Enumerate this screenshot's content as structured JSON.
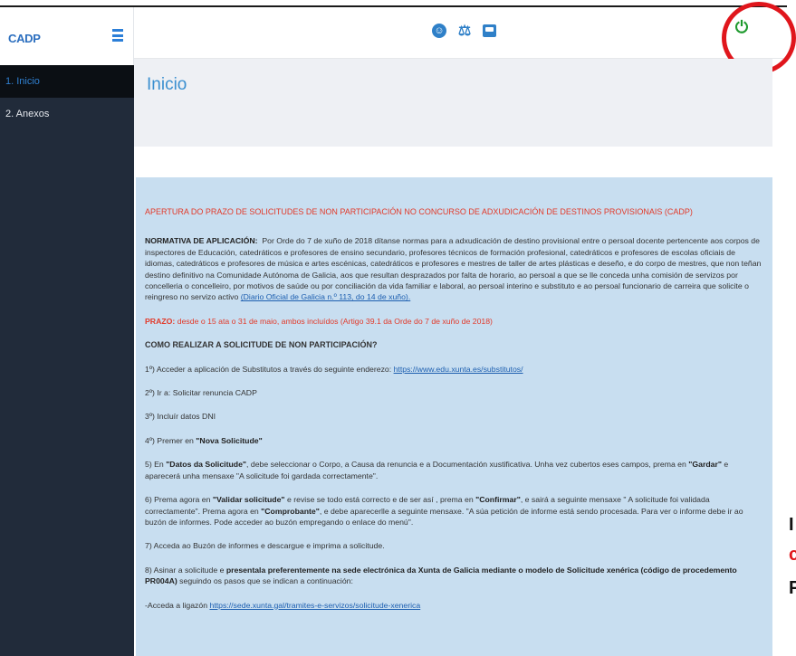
{
  "app": {
    "brand": "CADP"
  },
  "sidebar": {
    "items": [
      {
        "label": "1. Inicio"
      },
      {
        "label": "2. Anexos"
      }
    ]
  },
  "page": {
    "title": "Inicio"
  },
  "content": {
    "announcement_title": "APERTURA DO PRAZO DE SOLICITUDES DE NON PARTICIPACIÓN NO CONCURSO DE ADXUDICACIÓN DE DESTINOS PROVISIONAIS (CADP)",
    "normativa_label": "NORMATIVA DE APLICACIÓN:",
    "normativa_text": "Por Orde do 7 de xuño de 2018 dítanse normas para a adxudicación de destino provisional entre o persoal docente pertencente aos corpos de inspectores de Educación, catedráticos e profesores de ensino secundario, profesores técnicos de formación profesional, catedráticos e profesores de escolas oficiais de idiomas, catedráticos e profesores de música e artes escénicas, catedráticos e profesores e mestres de taller de artes plásticas e deseño, e do corpo de mestres, que non teñan destino definitivo na Comunidade Autónoma de Galicia, aos que resultan desprazados por falta de horario, ao persoal a que se lle conceda unha comisión de servizos por concelleria o concelleiro, por motivos de saúde ou por conciliación da vida familiar e laboral, ao persoal interino e substituto e ao persoal funcionario de carreira que solicite o reingreso no servizo activo",
    "normativa_link": "(Diario Oficial de Galicia n.º 113, do 14 de xuño).",
    "prazo_label": "PRAZO:",
    "prazo_text": "desde o 15 ata o 31 de maio, ambos incluídos (Artigo 39.1 da Orde do 7 de xuño de 2018)",
    "how_title": "COMO REALIZAR A SOLICITUDE DE NON PARTICIPACIÓN?",
    "step1_text": "1º) Acceder a aplicación de Substitutos a través do seguinte enderezo:",
    "step1_link": "https://www.edu.xunta.es/substitutos/",
    "step2": "2º) Ir a: Solicitar renuncia CADP",
    "step3": "3º) Incluír datos DNI",
    "step4_a": "4º) Premer en ",
    "step4_b": "\"Nova Solicitude\"",
    "step5_a": "5) En ",
    "step5_b": "\"Datos da Solicitude\"",
    "step5_c": ", debe seleccionar o Corpo, a Causa da renuncia e a Documentación xustificativa. Unha vez cubertos eses campos, prema en ",
    "step5_d": "\"Gardar\"",
    "step5_e": " e aparecerá unha mensaxe \"A solicitude foi gardada correctamente\".",
    "step6_a": "6) Prema agora en ",
    "step6_b": "\"Validar solicitude\"",
    "step6_c": " e revise se todo está correcto e de ser así , prema en ",
    "step6_d": "\"Confirmar\"",
    "step6_e": ", e sairá a seguinte mensaxe \" A solicitude foi validada correctamente\". Prema agora en ",
    "step6_f": "\"Comprobante\"",
    "step6_g": ", e debe aparecerlle a seguinte mensaxe. \"A súa petición de informe está sendo procesada. Para ver o informe debe ir ao buzón de informes. Pode acceder ao buzón empregando o enlace do menú\".",
    "step7": "7) Acceda ao Buzón de informes e descargue e imprima a solicitude.",
    "step8_a": "8) Asinar a solicitude e ",
    "step8_b": "presentala preferentemente na sede electrónica da Xunta de Galicia mediante o modelo de Solicitude xenérica (código de procedemento PR004A)",
    "step8_c": " seguindo os pasos que se indican a continuación:",
    "step9_text": "-Acceda a ligazón",
    "step9_link": "https://sede.xunta.gal/tramites-e-servizos/solicitude-xenerica"
  },
  "edge_glyphs": [
    "I",
    "c",
    "P"
  ],
  "colors": {
    "sidebar_bg": "#212b3a",
    "accent_blue": "#2f80c8",
    "alert_red": "#e23a2a",
    "panel_bg": "#c8def0",
    "power_green": "#1f9a2e",
    "highlight_circle": "#e0161c"
  }
}
